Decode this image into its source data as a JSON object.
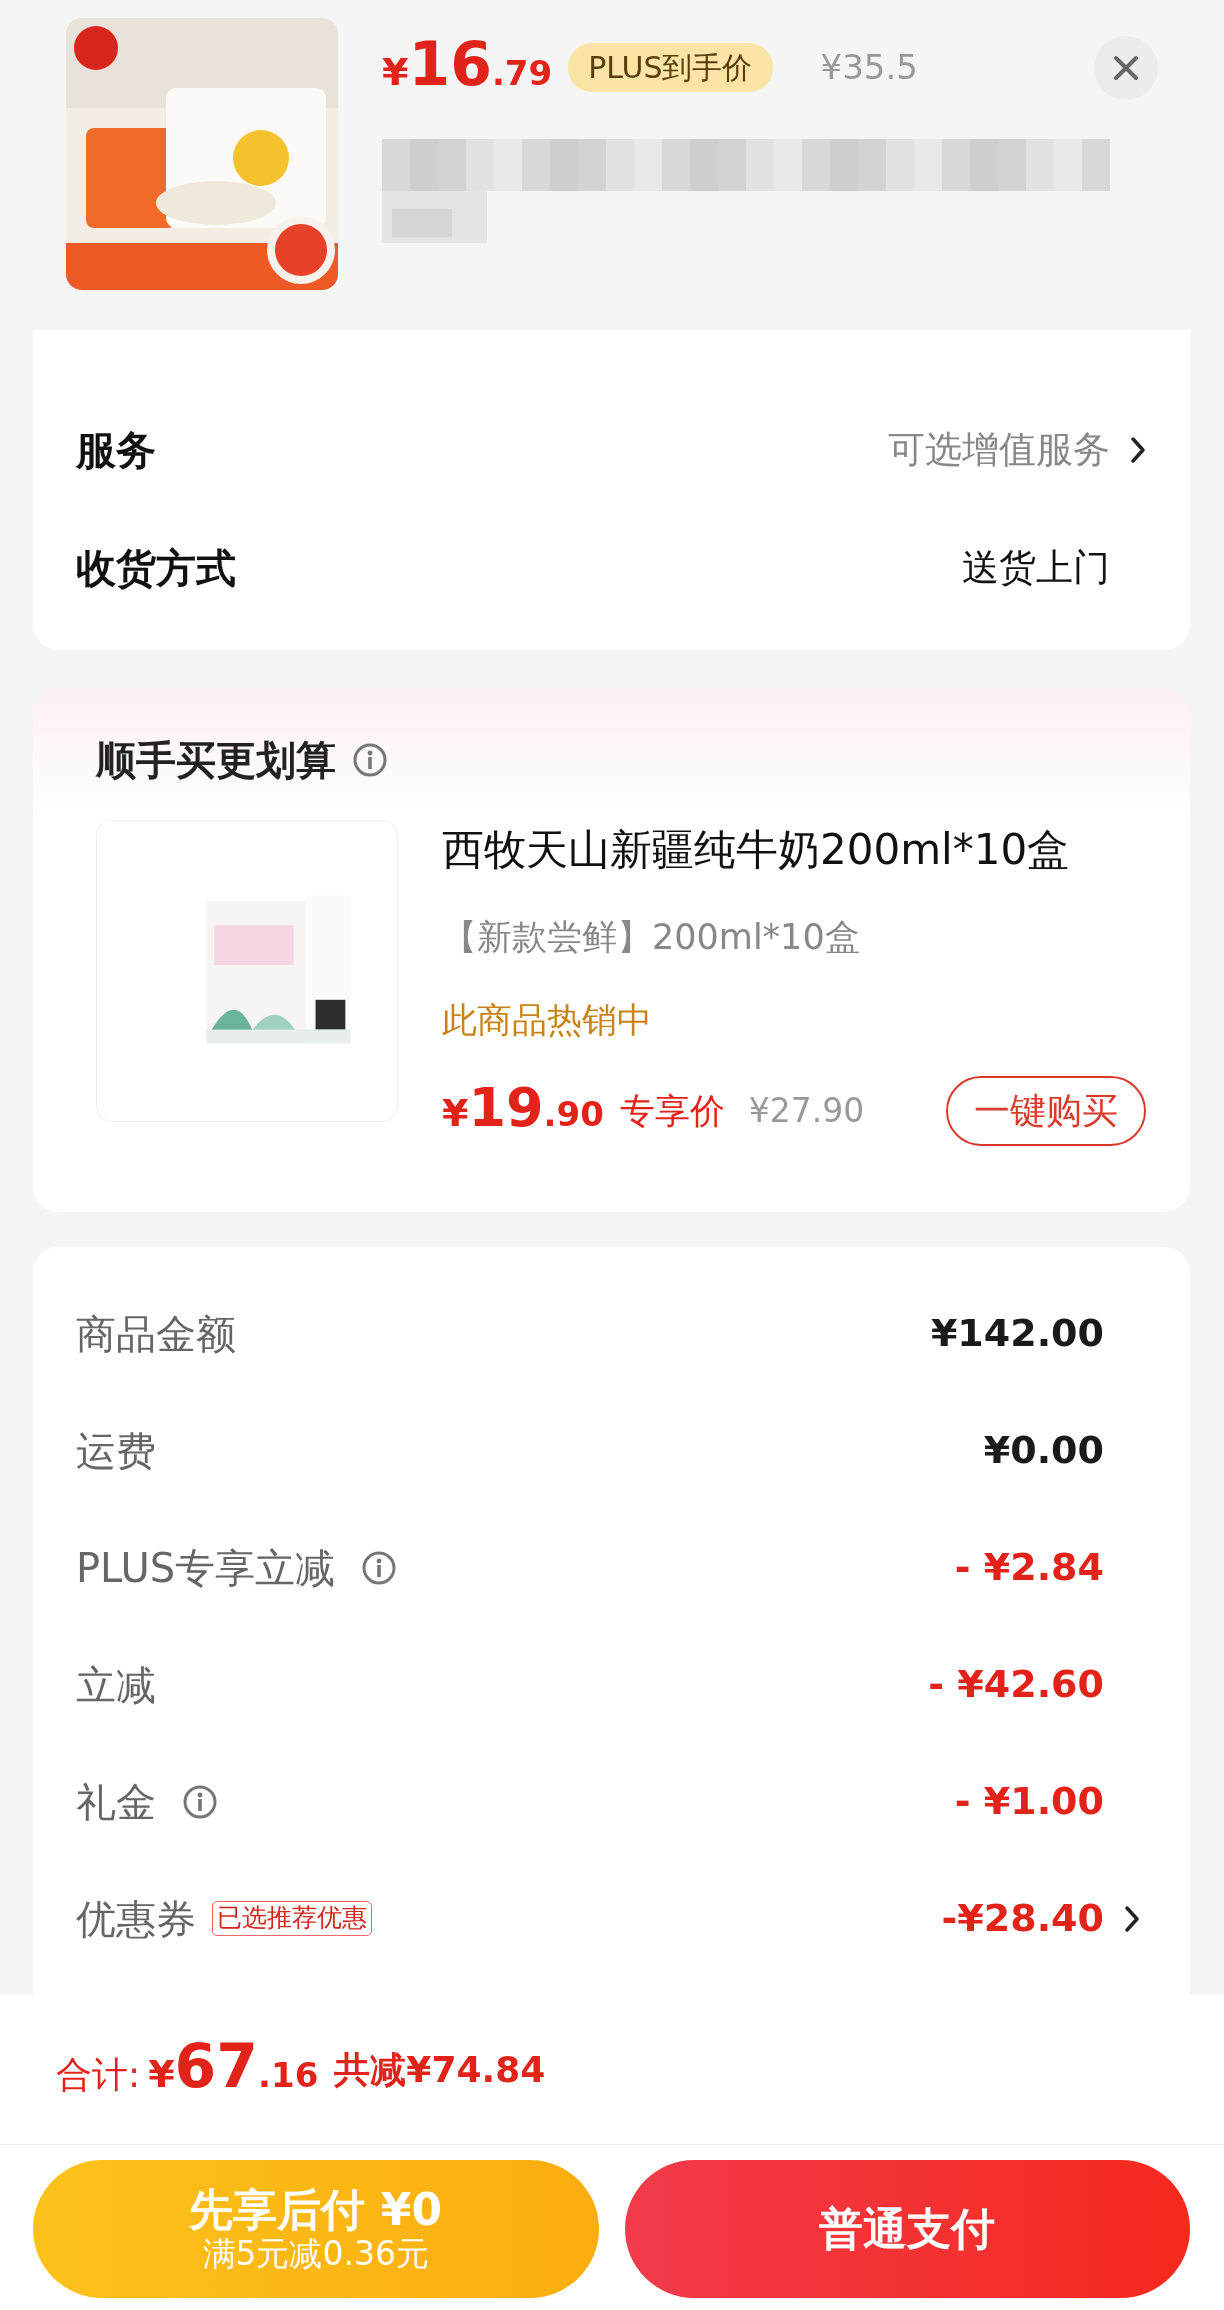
{
  "header": {
    "price_symbol": "¥",
    "price_int": "16",
    "price_dec": ".79",
    "price_tag": "PLUS到手价",
    "original_price": "¥35.5"
  },
  "options": [
    {
      "label": "服务",
      "value": "可选增值服务",
      "muted": true,
      "chevron": true
    },
    {
      "label": "收货方式",
      "value": "送货上门",
      "muted": false,
      "chevron": false
    }
  ],
  "deal": {
    "title": "顺手买更划算",
    "product": {
      "name": "西牧天山新疆纯牛奶200ml*10盒",
      "spec": "【新款尝鲜】200ml*10盒",
      "status": "此商品热销中",
      "price_symbol": "¥",
      "price_int": "19",
      "price_dec": ".90",
      "price_label": "专享价",
      "original_price": "¥27.90",
      "button": "一键购买"
    }
  },
  "summary": [
    {
      "label": "商品金额",
      "value": "¥142.00",
      "kind": "amount",
      "info": false,
      "chevron": false
    },
    {
      "label": "运费",
      "value": "¥0.00",
      "kind": "amount",
      "info": false,
      "chevron": false
    },
    {
      "label": "PLUS专享立减",
      "value": "- ¥2.84",
      "kind": "discount",
      "info": true,
      "chevron": false
    },
    {
      "label": "立减",
      "value": "- ¥42.60",
      "kind": "discount",
      "info": false,
      "chevron": false
    },
    {
      "label": "礼金",
      "value": "- ¥1.00",
      "kind": "discount",
      "info": true,
      "chevron": false
    },
    {
      "label": "优惠券",
      "tag": "已选推荐优惠",
      "value": "-¥28.40",
      "kind": "discount",
      "info": false,
      "chevron": true
    }
  ],
  "total": {
    "label": "合计:",
    "symbol": "¥",
    "int": "67",
    "dec": ".16",
    "saved": "共减¥74.84"
  },
  "buttons": [
    {
      "kind": "later",
      "title": "先享后付 ¥0",
      "subtitle": "满5元减0.36元"
    },
    {
      "kind": "pay",
      "title": "普通支付"
    }
  ]
}
